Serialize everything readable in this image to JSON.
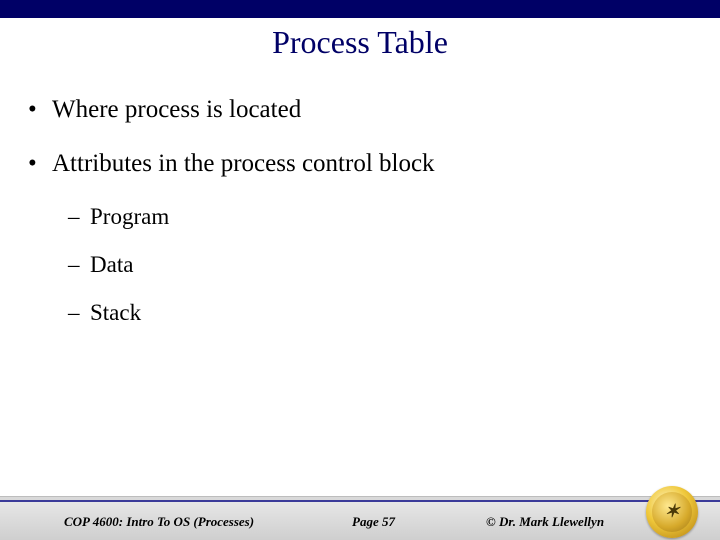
{
  "title": "Process Table",
  "bullets": {
    "b1": "Where process is located",
    "b2": "Attributes in the process control block",
    "s1": "Program",
    "s2": "Data",
    "s3": "Stack"
  },
  "footer": {
    "course": "COP 4600: Intro To OS  (Processes)",
    "page": "Page 57",
    "author": "© Dr. Mark Llewellyn"
  },
  "logo": {
    "name": "UCF Pegasus seal",
    "glyph": "✶"
  }
}
